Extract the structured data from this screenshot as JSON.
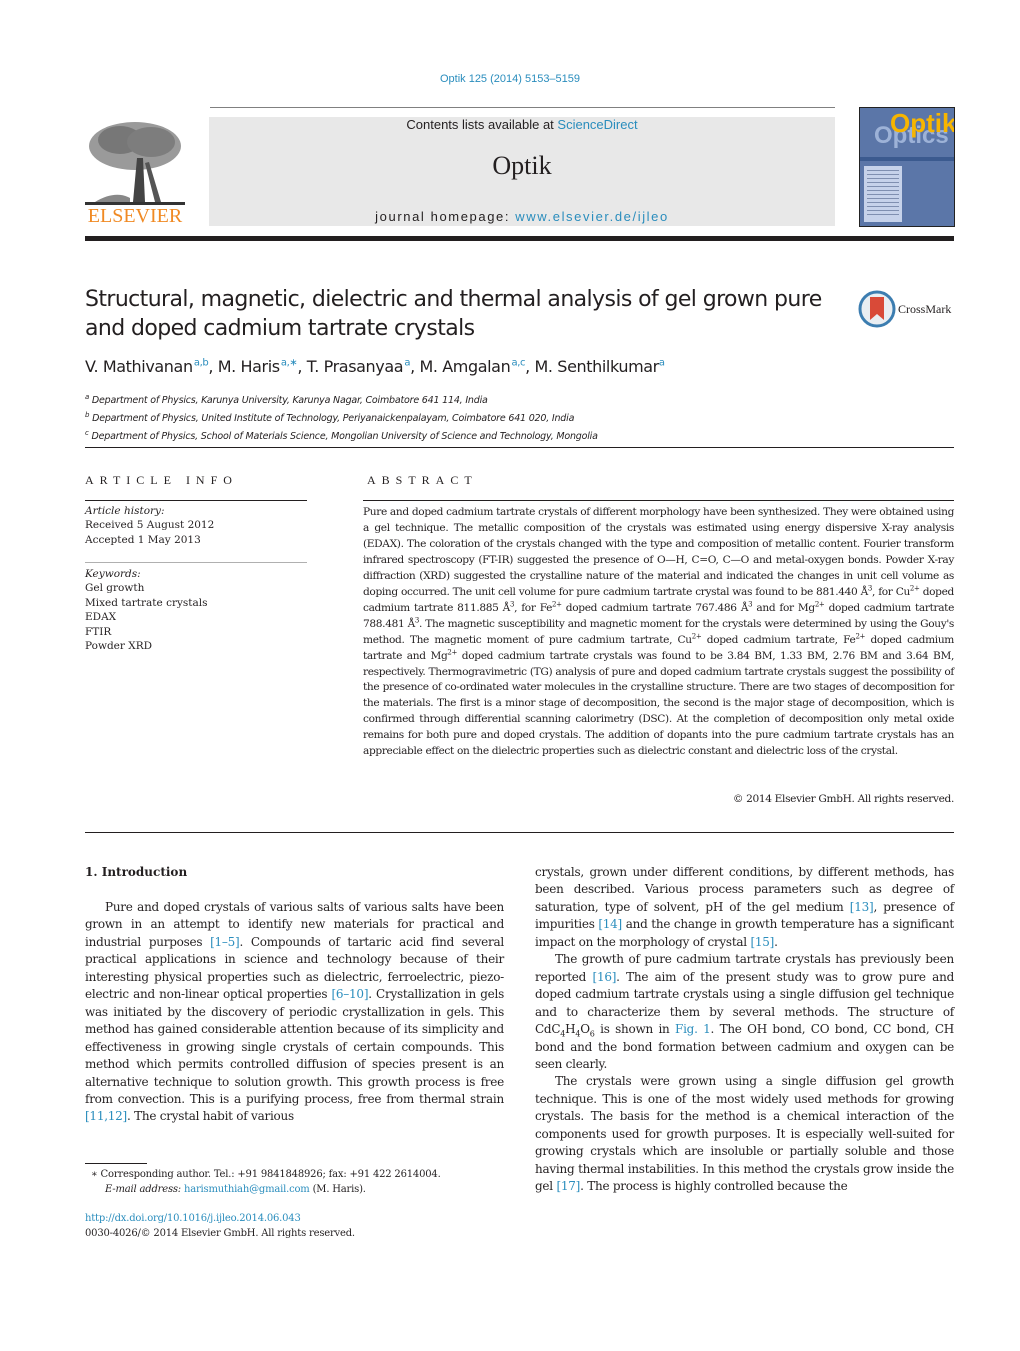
{
  "header": {
    "journal_ref": "Optik 125 (2014) 5153–5159",
    "contents_prefix": "Contents lists available at ",
    "contents_link": "ScienceDirect",
    "journal_title": "Optik",
    "homepage_prefix": "journal homepage: ",
    "homepage_link": "www.elsevier.de/ijleo",
    "publisher_logo_text": "ELSEVIER",
    "cover_title_top": "Optik",
    "cover_title_bottom": "Optics",
    "brand_color": "#f08a24",
    "link_color": "#2a8dbd"
  },
  "article": {
    "title": "Structural, magnetic, dielectric and thermal analysis of gel grown pure and doped cadmium tartrate crystals",
    "crossmark_label": "CrossMark",
    "authors": [
      {
        "name": "V. Mathivanan",
        "sup": "a,b",
        "sep": ", "
      },
      {
        "name": "M. Haris",
        "sup": "a,∗",
        "sep": ", "
      },
      {
        "name": "T. Prasanyaa",
        "sup": "a",
        "sep": ", "
      },
      {
        "name": "M. Amgalan",
        "sup": "a,c",
        "sep": ", "
      },
      {
        "name": "M. Senthilkumar",
        "sup": "a",
        "sep": ""
      }
    ],
    "affiliations": [
      {
        "mark": "a",
        "text": "Department of Physics, Karunya University, Karunya Nagar, Coimbatore 641 114, India"
      },
      {
        "mark": "b",
        "text": "Department of Physics, United Institute of Technology, Periyanaickenpalayam, Coimbatore 641 020, India"
      },
      {
        "mark": "c",
        "text": "Department of Physics, School of Materials Science, Mongolian University of Science and Technology, Mongolia"
      }
    ]
  },
  "article_info": {
    "heading": "ARTICLE INFO",
    "history_label": "Article history:",
    "received": "Received 5 August 2012",
    "accepted": "Accepted 1 May 2013",
    "keywords_label": "Keywords:",
    "keywords": [
      "Gel growth",
      "Mixed tartrate crystals",
      "EDAX",
      "FTIR",
      "Powder XRD"
    ]
  },
  "abstract": {
    "heading": "ABSTRACT",
    "p1": "Pure and doped cadmium tartrate crystals of different morphology have been synthesized. They were obtained using a gel technique. The metallic composition of the crystals was estimated using energy dispersive X-ray analysis (EDAX). The coloration of the crystals changed with the type and composition of metallic content. Fourier transform infrared spectroscopy (FT-IR) suggested the presence of O—H, C=O, C—O and metal-oxygen bonds. Powder X-ray diffraction (XRD) suggested the crystalline nature of the material and indicated the changes in unit cell volume as doping occurred. The unit cell volume for pure cadmium tartrate crystal was found to be 881.440 Å",
    "s1": "3",
    "p2": ", for Cu",
    "s2": "2+",
    "p3": " doped cadmium tartrate 811.885 Å",
    "s3": "3",
    "p4": ", for Fe",
    "s4": "2+",
    "p5": " doped cadmium tartrate 767.486 Å",
    "s5": "3",
    "p6": " and for Mg",
    "s6": "2+",
    "p7": " doped cadmium tartrate 788.481 Å",
    "s7": "3",
    "p8": ". The magnetic susceptibility and magnetic moment for the crystals were determined by using the Gouy's method. The magnetic moment of pure cadmium tartrate, Cu",
    "s8": "2+",
    "p9": " doped cadmium tartrate, Fe",
    "s9": "2+",
    "p10": " doped cadmium tartrate and Mg",
    "s10": "2+",
    "p11": " doped cadmium tartrate crystals was found to be 3.84 BM, 1.33 BM, 2.76 BM and 3.64 BM, respectively. Thermogravimetric (TG) analysis of pure and doped cadmium tartrate crystals suggest the possibility of the presence of co-ordinated water molecules in the crystalline structure. There are two stages of decomposition for the materials. The first is a minor stage of decomposition, the second is the major stage of decomposition, which is confirmed through differential scanning calorimetry (DSC). At the completion of decomposition only metal oxide remains for both pure and doped crystals. The addition of dopants into the pure cadmium tartrate crystals has an appreciable effect on the dielectric properties such as dielectric constant and dielectric loss of the crystal.",
    "copyright": "© 2014 Elsevier GmbH. All rights reserved."
  },
  "intro": {
    "heading": "1.  Introduction",
    "left_p1_a": "Pure and doped crystals of various salts of various salts have been grown in an attempt to identify new materials for practical and industrial purposes ",
    "left_ref1": "[1–5]",
    "left_p1_b": ". Compounds of tartaric acid find several practical applications in science and technology because of their interesting physical properties such as dielectric, ferroelectric, piezo-electric and non-linear optical properties ",
    "left_ref2": "[6–10]",
    "left_p1_c": ". Crystallization in gels was initiated by the discovery of periodic crystallization in gels. This method has gained considerable attention because of its simplicity and effectiveness in growing single crystals of certain compounds. This method which permits controlled diffusion of species present is an alternative technique to solution growth. This growth process is free from convection. This is a purifying process, free from thermal strain ",
    "left_ref3": "[11,12]",
    "left_p1_d": ". The crystal habit of various",
    "right_p0_a": "crystals, grown under different conditions, by different methods, has been described. Various process parameters such as degree of saturation, type of solvent, pH of the gel medium ",
    "right_ref13": "[13]",
    "right_p0_b": ", presence of impurities ",
    "right_ref14": "[14]",
    "right_p0_c": " and the change in growth temperature has a significant impact on the morphology of crystal ",
    "right_ref15": "[15]",
    "right_p0_d": ".",
    "right_p1_a": "The growth of pure cadmium tartrate crystals has previously been reported ",
    "right_ref16": "[16]",
    "right_p1_b": ". The aim of the present study was to grow pure and doped cadmium tartrate crystals using a single diffusion gel technique and to characterize them by several methods. The structure of CdC",
    "right_sub1": "4",
    "right_p1_c": "H",
    "right_sub2": "4",
    "right_p1_d": "O",
    "right_sub3": "6",
    "right_p1_e": " is shown in ",
    "right_fig": "Fig. 1",
    "right_p1_f": ". The OH bond, CO bond, CC bond, CH bond and the bond formation between cadmium and oxygen can be seen clearly.",
    "right_p2_a": "The crystals were grown using a single diffusion gel growth technique. This is one of the most widely used methods for growing crystals. The basis for the method is a chemical interaction of the components used for growth purposes. It is especially well-suited for growing crystals which are insoluble or partially soluble and those having thermal instabilities. In this method the crystals grow inside the gel ",
    "right_ref17": "[17]",
    "right_p2_b": ". The process is highly controlled because the"
  },
  "footnote": {
    "mark": "∗",
    "corresponding": " Corresponding author. Tel.: +91 9841848926; fax: +91 422 2614004.",
    "email_label": "E-mail address: ",
    "email": "harismuthiah@gmail.com",
    "email_suffix": " (M. Haris).",
    "doi": "http://dx.doi.org/10.1016/j.ijleo.2014.06.043",
    "issn": "0030-4026/© 2014 Elsevier GmbH. All rights reserved."
  }
}
